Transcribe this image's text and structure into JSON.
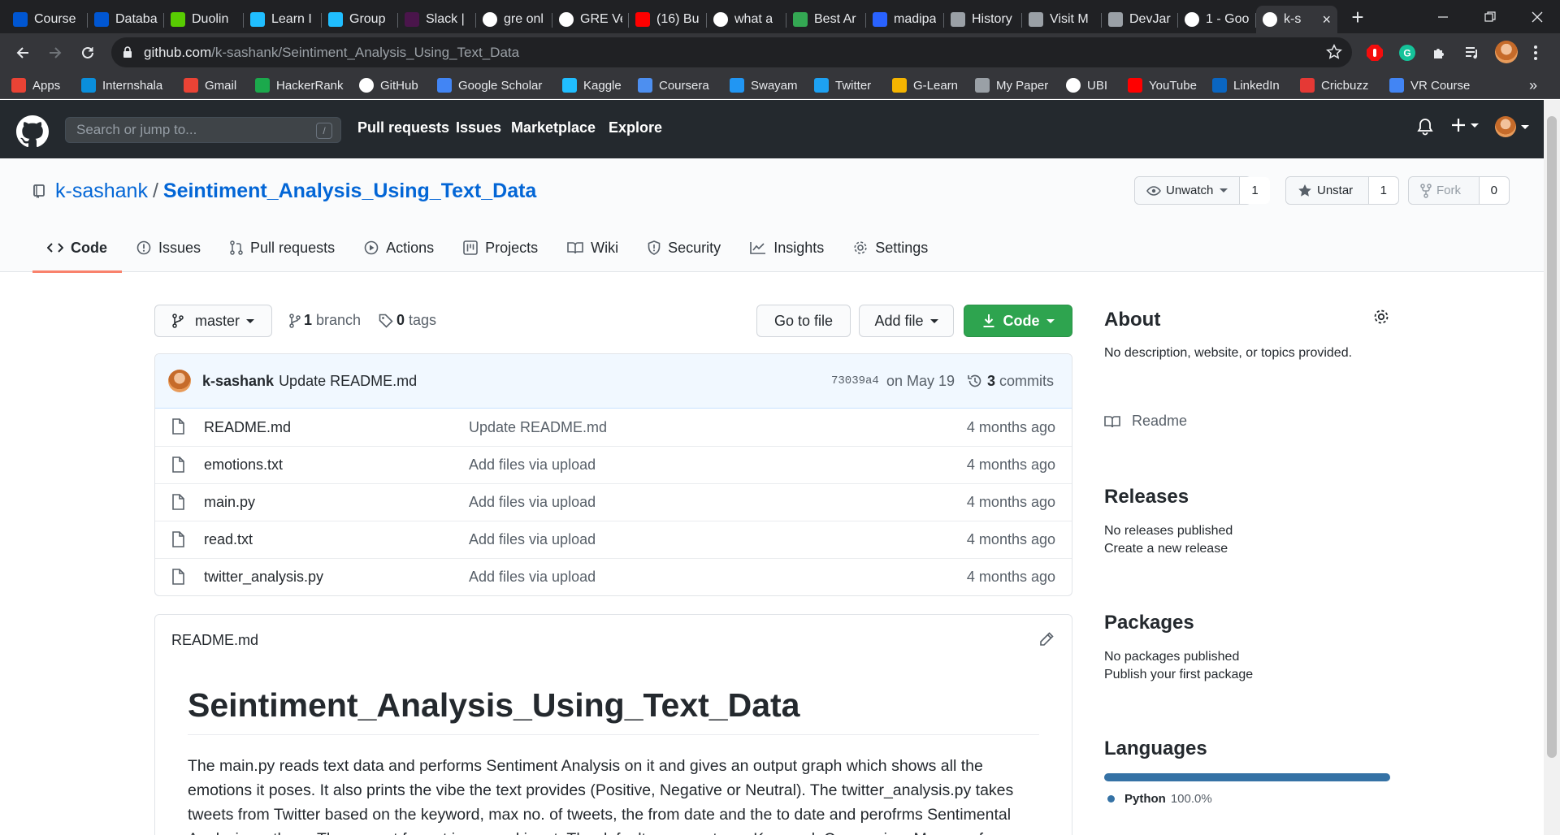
{
  "browser": {
    "tabs": [
      {
        "label": "Course",
        "icon": "coursera-icon",
        "color": "#0056d2"
      },
      {
        "label": "Databa",
        "icon": "coursera-icon",
        "color": "#0056d2"
      },
      {
        "label": "Duolin",
        "icon": "duolingo-icon",
        "color": "#58cc02"
      },
      {
        "label": "Learn I",
        "icon": "kaggle-icon",
        "color": "#20beff"
      },
      {
        "label": "Group",
        "icon": "kaggle-icon",
        "color": "#20beff"
      },
      {
        "label": "Slack |",
        "icon": "slack-icon",
        "color": "#4a154b"
      },
      {
        "label": "gre onl",
        "icon": "google-icon",
        "color": "#ffffff"
      },
      {
        "label": "GRE Ve",
        "icon": "google-icon",
        "color": "#ffffff"
      },
      {
        "label": "(16) Bu",
        "icon": "youtube-icon",
        "color": "#ff0000"
      },
      {
        "label": "what a",
        "icon": "google-icon",
        "color": "#ffffff"
      },
      {
        "label": "Best Ar",
        "icon": "green-app-icon",
        "color": "#34a853"
      },
      {
        "label": "madipa",
        "icon": "blue-app-icon",
        "color": "#2962ff"
      },
      {
        "label": "History",
        "icon": "history-icon",
        "color": "#9aa0a6"
      },
      {
        "label": "Visit M",
        "icon": "globe-icon",
        "color": "#9aa0a6"
      },
      {
        "label": "DevJar",
        "icon": "globe-icon",
        "color": "#9aa0a6"
      },
      {
        "label": "1 - Goo",
        "icon": "google-icon",
        "color": "#ffffff"
      },
      {
        "label": "k-s",
        "icon": "github-icon",
        "color": "#ffffff",
        "active": true
      }
    ],
    "url_host": "github.com",
    "url_path": "/k-sashank/Seintiment_Analysis_Using_Text_Data",
    "bookmarks": [
      {
        "label": "Apps",
        "icon": "apps-grid-icon",
        "color": "#ea4335"
      },
      {
        "label": "Internshala",
        "icon": "internshala-icon",
        "color": "#0a8fdc"
      },
      {
        "label": "Gmail",
        "icon": "gmail-icon",
        "color": "#ea4335"
      },
      {
        "label": "HackerRank",
        "icon": "hackerrank-icon",
        "color": "#1ba94c"
      },
      {
        "label": "GitHub",
        "icon": "github-icon",
        "color": "#ffffff"
      },
      {
        "label": "Google Scholar",
        "icon": "scholar-icon",
        "color": "#4285f4"
      },
      {
        "label": "Kaggle",
        "icon": "kaggle-icon",
        "color": "#20beff"
      },
      {
        "label": "Coursera",
        "icon": "coursera-icon",
        "color": "#4d8ff0"
      },
      {
        "label": "Swayam",
        "icon": "swayam-icon",
        "color": "#2196f3"
      },
      {
        "label": "Twitter",
        "icon": "twitter-icon",
        "color": "#1da1f2"
      },
      {
        "label": "G-Learn",
        "icon": "glearn-icon",
        "color": "#f4b400"
      },
      {
        "label": "My Paper",
        "icon": "globe-icon",
        "color": "#9aa0a6"
      },
      {
        "label": "UBI",
        "icon": "ubi-icon",
        "color": "#ffffff"
      },
      {
        "label": "YouTube",
        "icon": "youtube-icon",
        "color": "#ff0000"
      },
      {
        "label": "LinkedIn",
        "icon": "linkedin-icon",
        "color": "#0a66c2"
      },
      {
        "label": "Cricbuzz",
        "icon": "cricbuzz-icon",
        "color": "#e53935"
      },
      {
        "label": "VR Course",
        "icon": "vr-icon",
        "color": "#4285f4"
      }
    ],
    "bookmarks_overflow": "»"
  },
  "github": {
    "search_placeholder": "Search or jump to...",
    "search_shortcut": "/",
    "nav": [
      "Pull requests",
      "Issues",
      "Marketplace",
      "Explore"
    ]
  },
  "repo": {
    "owner": "k-sashank",
    "separator": "/",
    "name": "Seintiment_Analysis_Using_Text_Data",
    "watch_label": "Unwatch",
    "watch_count": "1",
    "star_label": "Unstar",
    "star_count": "1",
    "fork_label": "Fork",
    "fork_count": "0",
    "tabs": [
      "Code",
      "Issues",
      "Pull requests",
      "Actions",
      "Projects",
      "Wiki",
      "Security",
      "Insights",
      "Settings"
    ],
    "selected_tab": "Code"
  },
  "code": {
    "branch": "master",
    "branch_count": "1",
    "branch_label": "branch",
    "tag_count": "0",
    "tag_label": "tags",
    "goto_file": "Go to file",
    "add_file": "Add file",
    "code_button": "Code",
    "latest_commit": {
      "author": "k-sashank",
      "message": "Update README.md",
      "sha": "73039a4",
      "date": "on May 19",
      "commit_count": "3",
      "commit_label": "commits"
    },
    "files": [
      {
        "name": "README.md",
        "message": "Update README.md",
        "age": "4 months ago"
      },
      {
        "name": "emotions.txt",
        "message": "Add files via upload",
        "age": "4 months ago"
      },
      {
        "name": "main.py",
        "message": "Add files via upload",
        "age": "4 months ago"
      },
      {
        "name": "read.txt",
        "message": "Add files via upload",
        "age": "4 months ago"
      },
      {
        "name": "twitter_analysis.py",
        "message": "Add files via upload",
        "age": "4 months ago"
      }
    ],
    "readme": {
      "filename": "README.md",
      "heading": "Seintiment_Analysis_Using_Text_Data",
      "body": "The main.py reads text data and performs Sentiment Analysis on it and gives an output graph which shows all the emotions it poses. It also prints the vibe the text provides (Positive, Negative or Neutral). The twitter_analysis.py takes tweets from Twitter based on the keyword, max no. of tweets, the from date and the to date and perofrms Sentimental Analysis on them. The current format is manual input. The default argument are: Keyword: Coronavirus Max no of"
    }
  },
  "sidebar": {
    "about_title": "About",
    "about_desc": "No description, website, or topics provided.",
    "readme_link": "Readme",
    "releases_title": "Releases",
    "releases_text": "No releases published",
    "releases_link": "Create a new release",
    "packages_title": "Packages",
    "packages_text": "No packages published",
    "packages_link": "Publish your first package",
    "languages_title": "Languages",
    "language": {
      "name": "Python",
      "percent": "100.0%",
      "share": 1.0,
      "color": "#3572a5"
    }
  }
}
